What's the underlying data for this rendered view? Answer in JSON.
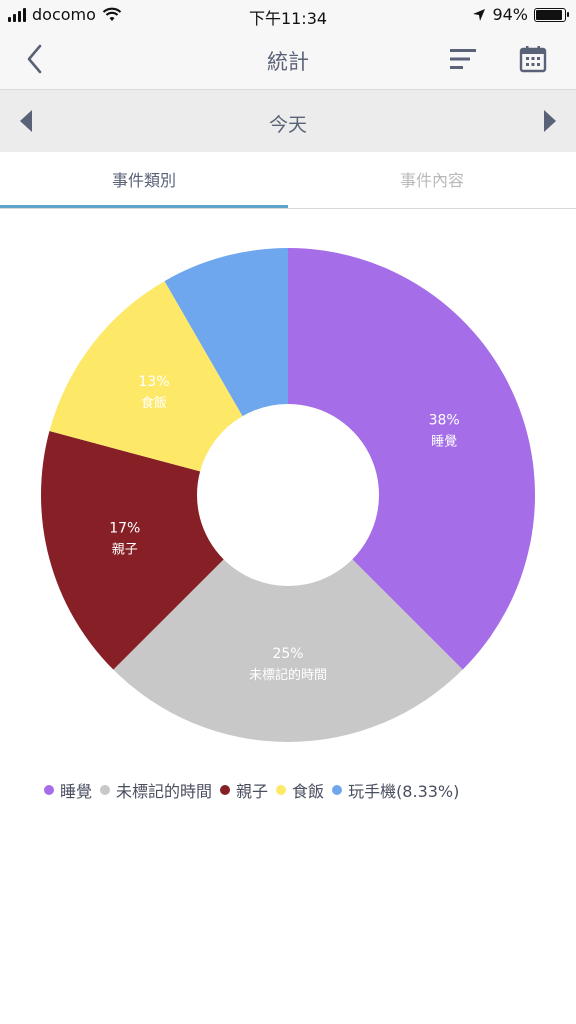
{
  "status_bar": {
    "carrier": "docomo",
    "time": "下午11:34",
    "battery": "94%",
    "battery_level": 0.94
  },
  "header": {
    "title": "統計",
    "back_icon": "chevron-left-icon",
    "sort_icon": "sort-lines-icon",
    "calendar_icon": "calendar-icon"
  },
  "date_nav": {
    "label": "今天",
    "prev_icon": "triangle-left-icon",
    "next_icon": "triangle-right-icon"
  },
  "tabs": [
    {
      "label": "事件類別",
      "active": true
    },
    {
      "label": "事件內容",
      "active": false
    }
  ],
  "colors": {
    "accent": "#5ea3c9",
    "text": "#5a6278",
    "sleep": "#a56de8",
    "untagged": "#c8c8c8",
    "parenting": "#862026",
    "meal": "#fde868",
    "phone": "#6fa7ee"
  },
  "chart_data": {
    "type": "pie",
    "donut": true,
    "start_angle_deg": 0,
    "slices": [
      {
        "name": "睡覺",
        "value": 37.5,
        "label": "38%",
        "color": "#a56de8"
      },
      {
        "name": "未標記的時間",
        "value": 25,
        "label": "25%",
        "color": "#c8c8c8"
      },
      {
        "name": "親子",
        "value": 16.67,
        "label": "17%",
        "color": "#862026"
      },
      {
        "name": "食飯",
        "value": 12.5,
        "label": "13%",
        "color": "#fde868"
      },
      {
        "name": "玩手機",
        "value": 8.33,
        "label": "",
        "color": "#6fa7ee"
      }
    ],
    "legend": [
      {
        "label": "睡覺",
        "color": "#a56de8"
      },
      {
        "label": "未標記的時間",
        "color": "#c8c8c8"
      },
      {
        "label": "親子",
        "color": "#862026"
      },
      {
        "label": "食飯",
        "color": "#fde868"
      },
      {
        "label": "玩手機(8.33%)",
        "color": "#6fa7ee"
      }
    ],
    "legend_position": "bottom-left"
  }
}
